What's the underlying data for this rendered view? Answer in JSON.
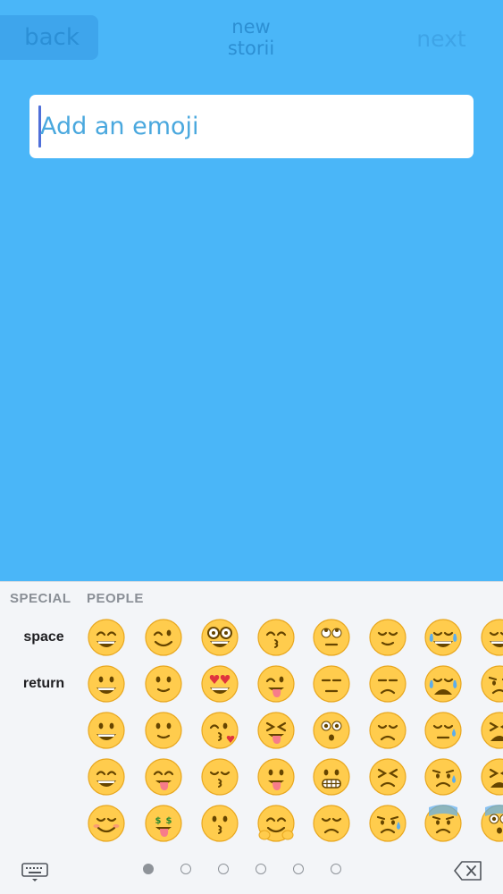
{
  "nav": {
    "back_label": "back",
    "title_line1": "new",
    "title_line2": "storii",
    "next_label": "next"
  },
  "input": {
    "placeholder": "Add an emoji",
    "value": ""
  },
  "keyboard": {
    "categories": [
      "SPECIAL",
      "PEOPLE"
    ],
    "space_label": "space",
    "return_label": "return",
    "emoji_rows": [
      [
        "grinning-smiling-eyes",
        "winking",
        "nerd",
        "kissing-smiling-eyes",
        "rolling-eyes",
        "relieved",
        "tears-of-joy",
        "grinning-cut"
      ],
      [
        "smiley",
        "slightly-smiling",
        "heart-eyes",
        "winking-tongue",
        "thinking",
        "unamused",
        "loudly-crying",
        "cold-sweat-cut"
      ],
      [
        "grinning",
        "upside-down",
        "kissing-heart",
        "squinting-tongue",
        "flushed",
        "disappointed",
        "sleepy",
        "weary-cut"
      ],
      [
        "smile",
        "yum",
        "kissing-closed-eyes",
        "tongue-out",
        "grimacing",
        "confounded",
        "sad-relieved",
        "tired-cut"
      ],
      [
        "blush",
        "money-mouth",
        "kissing",
        "hugging",
        "pensive",
        "crying",
        "fearful",
        "scream-cut"
      ]
    ],
    "pages": 6,
    "active_page": 1,
    "switch_icon": "keyboard-icon",
    "delete_icon": "backspace-icon"
  },
  "colors": {
    "background": "#4ab6f8",
    "keyboard": "#f3f5f8",
    "emoji_face": "#ffcc4d"
  }
}
